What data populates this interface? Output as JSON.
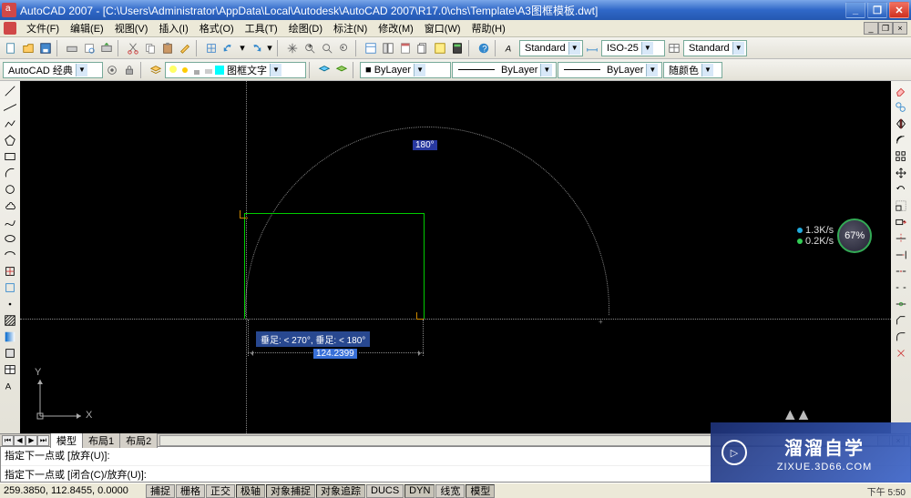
{
  "window": {
    "title": "AutoCAD 2007 - [C:\\Users\\Administrator\\AppData\\Local\\Autodesk\\AutoCAD 2007\\R17.0\\chs\\Template\\A3图框模板.dwt]"
  },
  "menu": {
    "file": "文件(F)",
    "edit": "编辑(E)",
    "view": "视图(V)",
    "insert": "插入(I)",
    "format": "格式(O)",
    "tools": "工具(T)",
    "draw": "绘图(D)",
    "dimension": "标注(N)",
    "modify": "修改(M)",
    "window": "窗口(W)",
    "help": "帮助(H)"
  },
  "toolbar1": {
    "textstyle": "Standard",
    "dimstyle": "ISO-25",
    "tablestyle": "Standard"
  },
  "toolbar2": {
    "workspace": "AutoCAD 经典",
    "layer_name": "图框文字",
    "color": "■ ByLayer",
    "linetype": "ByLayer",
    "lineweight": "ByLayer",
    "plotstyle": "随颜色"
  },
  "drawing": {
    "angle_label": "180°",
    "tooltip": "垂足: < 270°,  垂足: < 180°",
    "dyn_input": "124.2399",
    "ucs_x": "X",
    "ucs_y": "Y"
  },
  "netwidget": {
    "up": "1.3K/s",
    "down": "0.2K/s",
    "pct": "67%"
  },
  "tabs": {
    "model": "模型",
    "layout1": "布局1",
    "layout2": "布局2"
  },
  "cmd": {
    "line1": "指定下一点或 [放弃(U)]:",
    "line2": "指定下一点或 [闭合(C)/放弃(U)]:"
  },
  "status": {
    "coords": "259.3850, 112.8455, 0.0000",
    "snap": "捕捉",
    "grid": "栅格",
    "ortho": "正交",
    "polar": "极轴",
    "osnap": "对象捕捉",
    "otrack": "对象追踪",
    "ducs": "DUCS",
    "dyn": "DYN",
    "lwt": "线宽",
    "model": "模型",
    "clock": "下午 5:50"
  },
  "watermark": {
    "text": "溜溜自学",
    "url": "ZIXUE.3D66.COM",
    "play": "▷"
  }
}
